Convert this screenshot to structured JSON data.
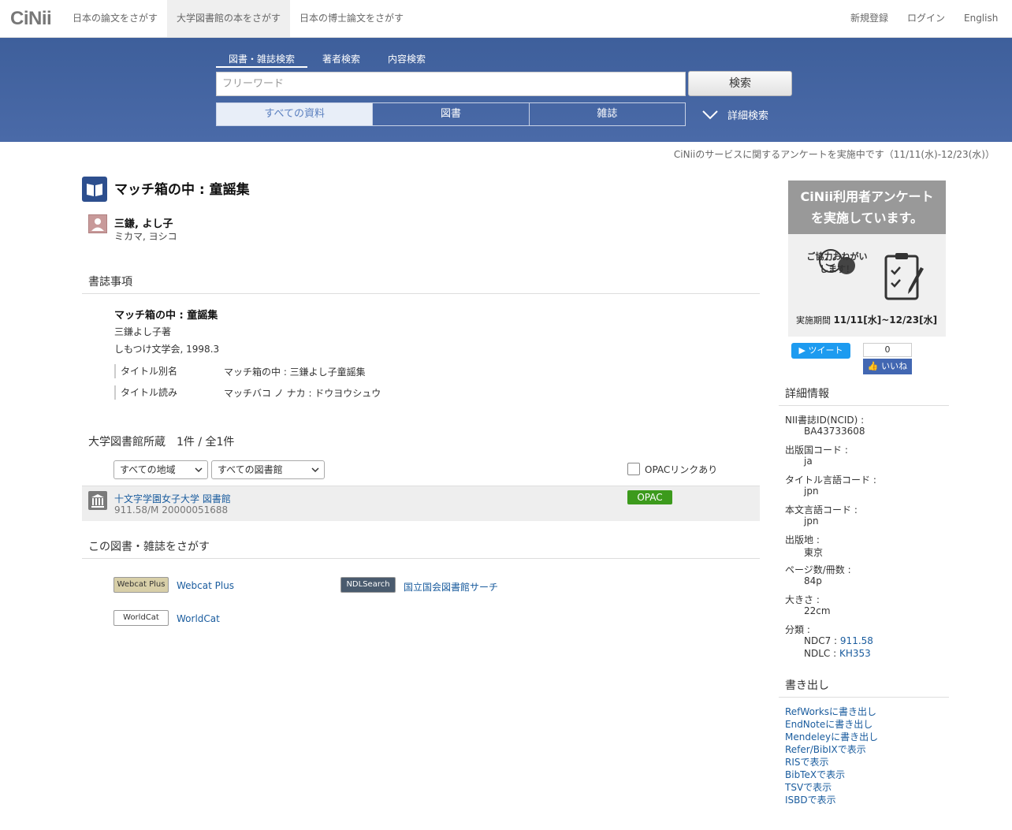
{
  "nav": {
    "logo": "CiNii",
    "tabs": [
      "日本の論文をさがす",
      "大学図書館の本をさがす",
      "日本の博士論文をさがす"
    ],
    "right": [
      "新規登録",
      "ログイン",
      "English"
    ]
  },
  "search": {
    "tabs": [
      "図書・雑誌検索",
      "著者検索",
      "内容検索"
    ],
    "placeholder": "フリーワード",
    "button": "検索",
    "types": [
      "すべての資料",
      "図書",
      "雑誌"
    ],
    "advanced": "詳細検索"
  },
  "notice": "CiNiiのサービスに関するアンケートを実施中です（11/11(水)-12/23(水)）",
  "book": {
    "title": "マッチ箱の中 : 童謡集",
    "author_name": "三鎌, よし子",
    "author_kana": "ミカマ, ヨシコ"
  },
  "bib": {
    "heading": "書誌事項",
    "title": "マッチ箱の中 : 童謡集",
    "statement": "三鎌よし子著",
    "publisher": "しもつけ文学会, 1998.3",
    "alt_title_label": "タイトル別名",
    "alt_title_value": "マッチ箱の中 : 三鎌よし子童謡集",
    "reading_label": "タイトル読み",
    "reading_value": "マッチバコ ノ ナカ : ドウヨウシュウ"
  },
  "holdings": {
    "heading": "大学図書館所蔵　1件 / 全1件",
    "region_select": "すべての地域",
    "library_select": "すべての図書館",
    "opac_filter": "OPACリンクあり",
    "library_name": "十文字学園女子大学 図書館",
    "call_number": "911.58/M  20000051688",
    "opac_badge": "OPAC"
  },
  "search_elsewhere": {
    "heading": "この図書・雑誌をさがす",
    "webcat_logo": "Webcat Plus",
    "webcat_link": "Webcat Plus",
    "ndl_logo": "NDLSearch",
    "ndl_link": "国立国会図書館サーチ",
    "worldcat_logo": "WorldCat",
    "worldcat_link": "WorldCat"
  },
  "banner": {
    "line1": "CiNii利用者アンケート",
    "line2": "を実施しています。",
    "mid1": "ご協力おねがい",
    "mid2": "します！",
    "period_label": "実施期間",
    "period_value": "11/11[水]~12/23[水]"
  },
  "social": {
    "tweet": "ツイート",
    "fb_count": "0",
    "fb_like": "いいね"
  },
  "details": {
    "heading": "詳細情報",
    "ncid_label": "NII書誌ID(NCID) :",
    "ncid_value": "BA43733608",
    "country_label": "出版国コード :",
    "country_value": "ja",
    "title_lang_label": "タイトル言語コード :",
    "title_lang_value": "jpn",
    "text_lang_label": "本文言語コード :",
    "text_lang_value": "jpn",
    "place_label": "出版地 :",
    "place_value": "東京",
    "pages_label": "ページ数/冊数 :",
    "pages_value": "84p",
    "size_label": "大きさ :",
    "size_value": "22cm",
    "class_label": "分類 :",
    "ndc7_label": "NDC7 :",
    "ndc7_value": "911.58",
    "ndlc_label": "NDLC :",
    "ndlc_value": "KH353"
  },
  "export": {
    "heading": "書き出し",
    "items": [
      "RefWorksに書き出し",
      "EndNoteに書き出し",
      "Mendeleyに書き出し",
      "Refer/BibIXで表示",
      "RISで表示",
      "BibTeXで表示",
      "TSVで表示",
      "ISBDで表示"
    ]
  }
}
